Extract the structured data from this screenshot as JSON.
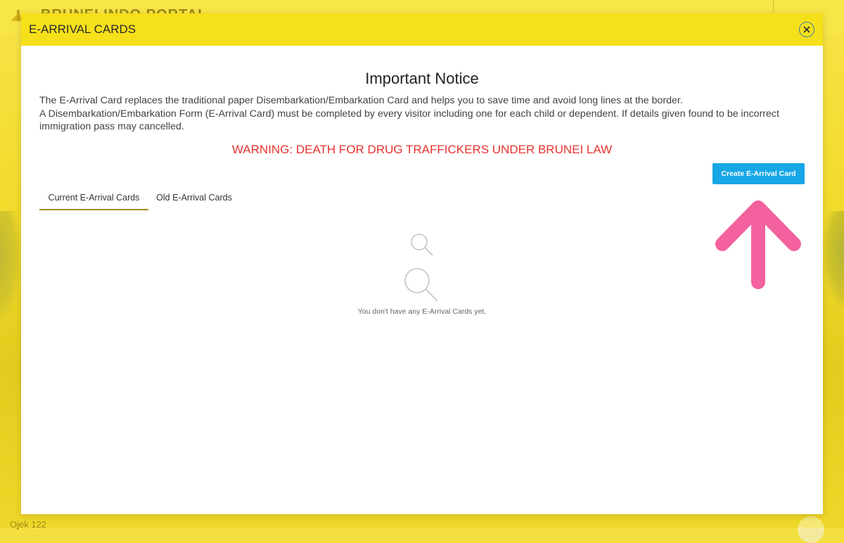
{
  "background": {
    "portal_title": "BRUNEI INDO PORTAL",
    "footer_text": "Ojek 122"
  },
  "modal": {
    "title": "E-ARRIVAL CARDS",
    "notice_title": "Important Notice",
    "notice_lines": [
      "The E-Arrival Card replaces the traditional paper Disembarkation/Embarkation Card and helps you to save time and avoid long lines at the border.",
      "A Disembarkation/Embarkation Form (E-Arrival Card) must be completed by every visitor including one for each child or dependent. If details given found to be incorrect immigration pass may cancelled."
    ],
    "warning": "WARNING: DEATH FOR DRUG TRAFFICKERS UNDER BRUNEI LAW",
    "create_button": "Create E-Arrival Card",
    "tabs": [
      {
        "label": "Current E-Arrival Cards",
        "active": true
      },
      {
        "label": "Old E-Arrival Cards",
        "active": false
      }
    ],
    "empty_message": "You don't have any E-Arrival Cards yet."
  },
  "icons": {
    "close": "close-icon",
    "empty_search_small": "search-icon",
    "empty_search_large": "search-icon",
    "annotation": "arrow-up-icon"
  },
  "colors": {
    "header_yellow": "#f6e01a",
    "button_blue": "#17a7e6",
    "warning_red": "#e8332f",
    "tab_underline": "#a08f12",
    "annotation_pink": "#f3619f"
  }
}
